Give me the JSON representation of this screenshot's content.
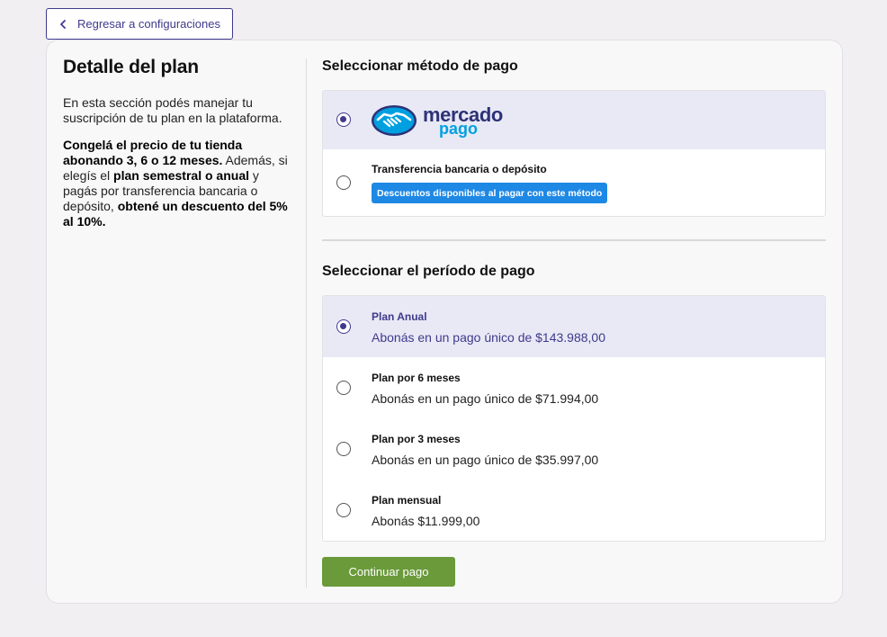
{
  "back_button": {
    "label": "Regresar a configuraciones"
  },
  "plan": {
    "title": "Detalle del plan",
    "intro": "En esta sección podés manejar tu suscripción de tu plan en la plataforma.",
    "promo": {
      "p1_bold": "Congelá el precio de tu tienda abonando 3, 6 o 12 meses.",
      "p2": " Además, si elegís el ",
      "p3_bold": "plan semestral o anual",
      "p4": " y pagás por transferencia bancaria o depósito, ",
      "p5_bold": "obtené un descuento del 5% al 10%."
    }
  },
  "payment_method": {
    "title": "Seleccionar método de pago",
    "options": [
      {
        "logo_word1": "mercado",
        "logo_word2": "pago",
        "icon": "handshake-icon",
        "selected": true
      },
      {
        "label": "Transferencia bancaria o depósito",
        "badge": "Descuentos disponibles al pagar con este método",
        "selected": false
      }
    ]
  },
  "payment_period": {
    "title": "Seleccionar el período de pago",
    "options": [
      {
        "label": "Plan Anual",
        "sub": "Abonás en un pago único de $143.988,00",
        "selected": true
      },
      {
        "label": "Plan por 6 meses",
        "sub": "Abonás en un pago único de $71.994,00",
        "selected": false
      },
      {
        "label": "Plan por 3 meses",
        "sub": "Abonás en un pago único de $35.997,00",
        "selected": false
      },
      {
        "label": "Plan mensual",
        "sub": "Abonás $11.999,00",
        "selected": false
      }
    ]
  },
  "continue_button": {
    "label": "Continuar pago"
  },
  "colors": {
    "accent": "#3f3a8c",
    "selected_bg": "#e8e9f5",
    "continue": "#6a9a3a",
    "badge": "#1e88e5",
    "mp_blue": "#00a0e0",
    "mp_navy": "#2d3277"
  }
}
